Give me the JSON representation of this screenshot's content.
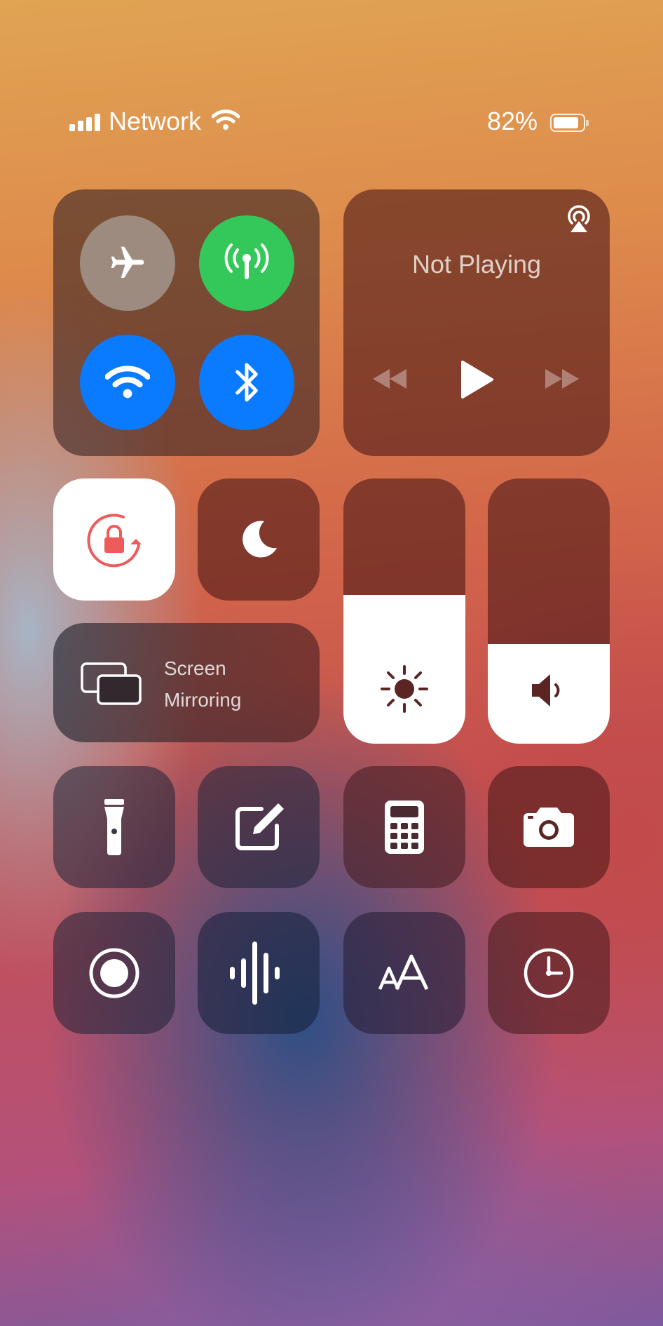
{
  "status_bar": {
    "carrier": "Network",
    "battery_percent": "82%",
    "battery_level": 0.82,
    "signal_bars": 4
  },
  "connectivity": {
    "airplane_mode": {
      "icon": "airplane-icon",
      "active": false
    },
    "cellular_data": {
      "icon": "antenna-icon",
      "active": true,
      "color": "#34c759"
    },
    "wifi": {
      "icon": "wifi-icon",
      "active": true,
      "color": "#0a7aff"
    },
    "bluetooth": {
      "icon": "bluetooth-icon",
      "active": true,
      "color": "#0a7aff"
    }
  },
  "now_playing": {
    "title": "Not Playing",
    "airplay_icon": "airplay-audio-icon",
    "controls": [
      "rewind-icon",
      "play-icon",
      "fast-forward-icon"
    ]
  },
  "toggles": {
    "orientation_lock": {
      "icon": "rotation-lock-icon",
      "active": true
    },
    "do_not_disturb": {
      "icon": "moon-icon",
      "active": false
    }
  },
  "screen_mirroring": {
    "label_line1": "Screen",
    "label_line2": "Mirroring",
    "icon": "screen-mirroring-icon"
  },
  "sliders": {
    "brightness": {
      "icon": "sun-icon",
      "level": 0.56
    },
    "volume": {
      "icon": "speaker-icon",
      "level": 0.38
    }
  },
  "shortcuts_row1": [
    "flashlight-icon",
    "notes-icon",
    "calculator-icon",
    "camera-icon"
  ],
  "shortcuts_row2": [
    "screen-record-icon",
    "voice-memo-icon",
    "text-size-icon",
    "clock-icon"
  ]
}
